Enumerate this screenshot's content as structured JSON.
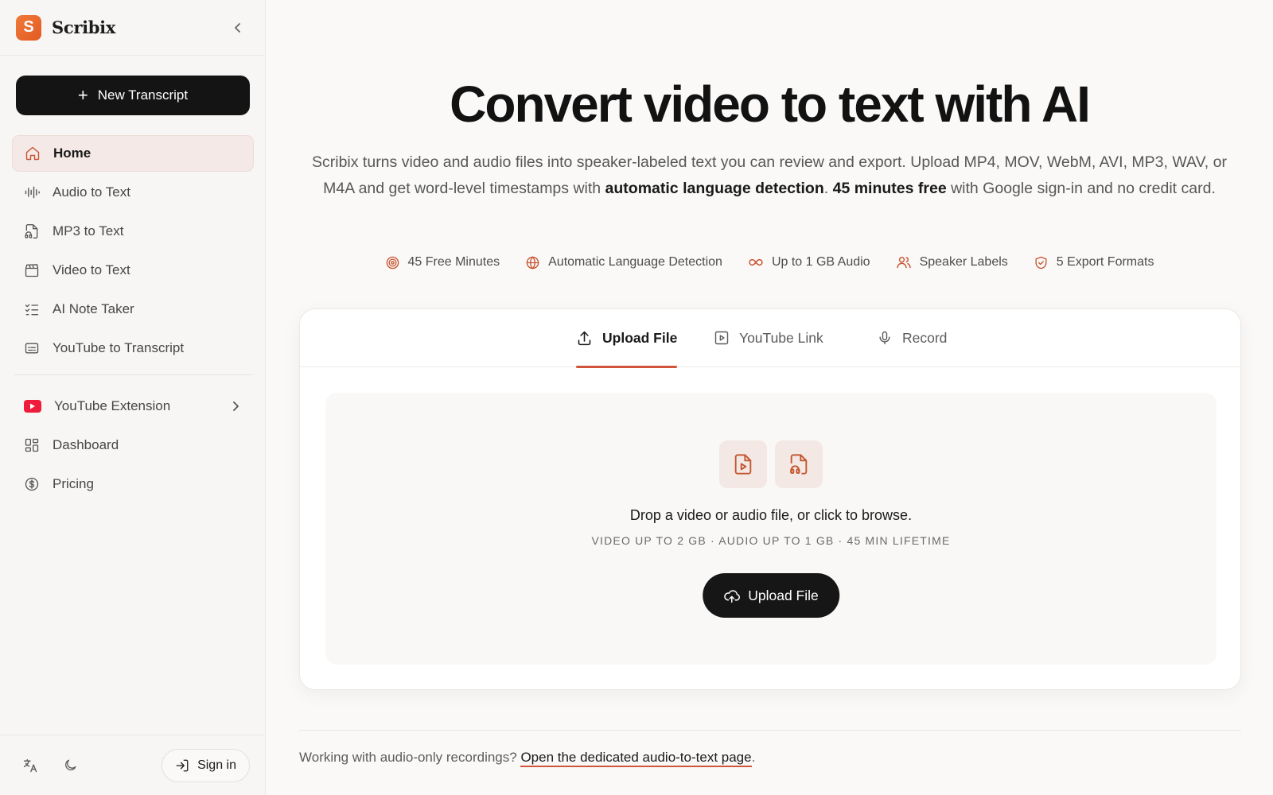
{
  "app": {
    "name": "Scribix",
    "logo_letter": "S",
    "accent": "#d0553a",
    "brand": "#e8642a"
  },
  "sidebar": {
    "new_button_label": "New Transcript",
    "items": [
      {
        "label": "Home",
        "icon": "home-icon",
        "active": true
      },
      {
        "label": "Audio to Text",
        "icon": "waveform-icon"
      },
      {
        "label": "MP3 to Text",
        "icon": "audio-file-icon"
      },
      {
        "label": "Video to Text",
        "icon": "clapperboard-icon"
      },
      {
        "label": "AI Note Taker",
        "icon": "checklist-icon"
      },
      {
        "label": "YouTube to Transcript",
        "icon": "captions-icon"
      }
    ],
    "secondary": [
      {
        "label": "YouTube Extension",
        "icon": "youtube-icon"
      },
      {
        "label": "Dashboard",
        "icon": "dashboard-icon"
      },
      {
        "label": "Pricing",
        "icon": "dollar-circle-icon"
      }
    ],
    "footer": {
      "signin_label": "Sign in"
    }
  },
  "hero": {
    "title": "Convert video to text with AI",
    "desc_part1": "Scribix turns video and audio files into speaker-labeled text you can review and export. Upload MP4, MOV, WebM, AVI, MP3, WAV, or M4A and get word-level timestamps with ",
    "desc_bold1": "automatic language detection",
    "desc_part2": ". ",
    "desc_bold2": "45 minutes free",
    "desc_part3": " with Google sign-in and no credit card."
  },
  "features": [
    {
      "label": "45 Free Minutes",
      "icon": "target-icon"
    },
    {
      "label": "Automatic Language Detection",
      "icon": "globe-icon"
    },
    {
      "label": "Up to 1 GB Audio",
      "icon": "infinity-icon"
    },
    {
      "label": "Speaker Labels",
      "icon": "users-icon"
    },
    {
      "label": "5 Export Formats",
      "icon": "shield-check-icon"
    }
  ],
  "tabs": [
    {
      "label": "Upload File",
      "active": true
    },
    {
      "label": "YouTube Link"
    },
    {
      "label": "Record"
    }
  ],
  "upload": {
    "drop_text": "Drop a video or audio file, or click to browse.",
    "limits": "VIDEO UP TO 2 GB · AUDIO UP TO 1 GB · 45 MIN LIFETIME",
    "button_label": "Upload File"
  },
  "footer_note": {
    "text": "Working with audio-only recordings? ",
    "link": "Open the dedicated audio-to-text page",
    "end": "."
  }
}
